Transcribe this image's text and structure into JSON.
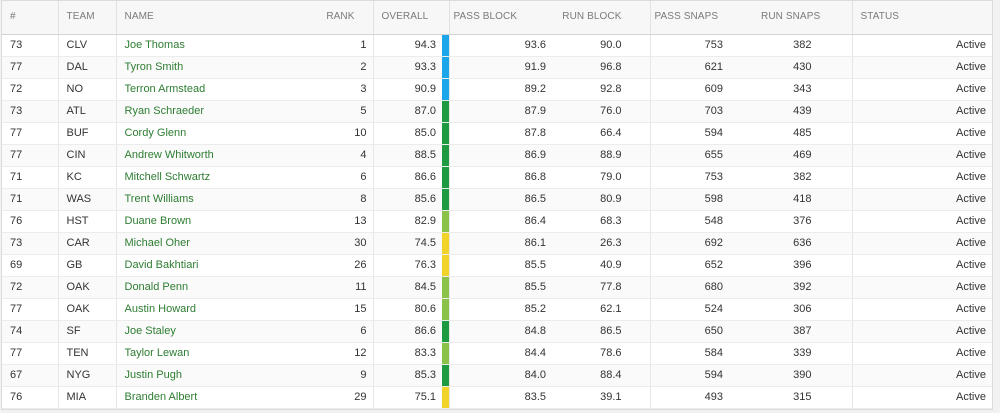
{
  "colors": {
    "tier_blue": "#1aa6e8",
    "tier_green_dark": "#1e9a41",
    "tier_green_light": "#8bc34a",
    "tier_yellow": "#f2d32a",
    "name_link": "#2e7d32"
  },
  "table": {
    "headers": {
      "num": "#",
      "team": "TEAM",
      "name": "NAME",
      "rank": "RANK",
      "overall": "OVERALL",
      "pass_block": "PASS BLOCK",
      "run_block": "RUN BLOCK",
      "pass_snaps": "PASS SNAPS",
      "run_snaps": "RUN SNAPS",
      "status": "STATUS"
    },
    "sort": {
      "column": "pass_block",
      "direction": "descending"
    },
    "rows": [
      {
        "num": "73",
        "team": "CLV",
        "name": "Joe Thomas",
        "rank": "1",
        "overall": "94.3",
        "tier": "blue",
        "pass_block": "93.6",
        "run_block": "90.0",
        "pass_snaps": "753",
        "run_snaps": "382",
        "status": "Active"
      },
      {
        "num": "77",
        "team": "DAL",
        "name": "Tyron Smith",
        "rank": "2",
        "overall": "93.3",
        "tier": "blue",
        "pass_block": "91.9",
        "run_block": "96.8",
        "pass_snaps": "621",
        "run_snaps": "430",
        "status": "Active"
      },
      {
        "num": "72",
        "team": "NO",
        "name": "Terron Armstead",
        "rank": "3",
        "overall": "90.9",
        "tier": "blue",
        "pass_block": "89.2",
        "run_block": "92.8",
        "pass_snaps": "609",
        "run_snaps": "343",
        "status": "Active"
      },
      {
        "num": "73",
        "team": "ATL",
        "name": "Ryan Schraeder",
        "rank": "5",
        "overall": "87.0",
        "tier": "green_dark",
        "pass_block": "87.9",
        "run_block": "76.0",
        "pass_snaps": "703",
        "run_snaps": "439",
        "status": "Active"
      },
      {
        "num": "77",
        "team": "BUF",
        "name": "Cordy Glenn",
        "rank": "10",
        "overall": "85.0",
        "tier": "green_dark",
        "pass_block": "87.8",
        "run_block": "66.4",
        "pass_snaps": "594",
        "run_snaps": "485",
        "status": "Active"
      },
      {
        "num": "77",
        "team": "CIN",
        "name": "Andrew Whitworth",
        "rank": "4",
        "overall": "88.5",
        "tier": "green_dark",
        "pass_block": "86.9",
        "run_block": "88.9",
        "pass_snaps": "655",
        "run_snaps": "469",
        "status": "Active"
      },
      {
        "num": "71",
        "team": "KC",
        "name": "Mitchell Schwartz",
        "rank": "6",
        "overall": "86.6",
        "tier": "green_dark",
        "pass_block": "86.8",
        "run_block": "79.0",
        "pass_snaps": "753",
        "run_snaps": "382",
        "status": "Active"
      },
      {
        "num": "71",
        "team": "WAS",
        "name": "Trent Williams",
        "rank": "8",
        "overall": "85.6",
        "tier": "green_dark",
        "pass_block": "86.5",
        "run_block": "80.9",
        "pass_snaps": "598",
        "run_snaps": "418",
        "status": "Active"
      },
      {
        "num": "76",
        "team": "HST",
        "name": "Duane Brown",
        "rank": "13",
        "overall": "82.9",
        "tier": "green_light",
        "pass_block": "86.4",
        "run_block": "68.3",
        "pass_snaps": "548",
        "run_snaps": "376",
        "status": "Active"
      },
      {
        "num": "73",
        "team": "CAR",
        "name": "Michael Oher",
        "rank": "30",
        "overall": "74.5",
        "tier": "yellow",
        "pass_block": "86.1",
        "run_block": "26.3",
        "pass_snaps": "692",
        "run_snaps": "636",
        "status": "Active"
      },
      {
        "num": "69",
        "team": "GB",
        "name": "David Bakhtiari",
        "rank": "26",
        "overall": "76.3",
        "tier": "yellow",
        "pass_block": "85.5",
        "run_block": "40.9",
        "pass_snaps": "652",
        "run_snaps": "396",
        "status": "Active"
      },
      {
        "num": "72",
        "team": "OAK",
        "name": "Donald Penn",
        "rank": "11",
        "overall": "84.5",
        "tier": "green_light",
        "pass_block": "85.5",
        "run_block": "77.8",
        "pass_snaps": "680",
        "run_snaps": "392",
        "status": "Active"
      },
      {
        "num": "77",
        "team": "OAK",
        "name": "Austin Howard",
        "rank": "15",
        "overall": "80.6",
        "tier": "green_light",
        "pass_block": "85.2",
        "run_block": "62.1",
        "pass_snaps": "524",
        "run_snaps": "306",
        "status": "Active"
      },
      {
        "num": "74",
        "team": "SF",
        "name": "Joe Staley",
        "rank": "6",
        "overall": "86.6",
        "tier": "green_dark",
        "pass_block": "84.8",
        "run_block": "86.5",
        "pass_snaps": "650",
        "run_snaps": "387",
        "status": "Active"
      },
      {
        "num": "77",
        "team": "TEN",
        "name": "Taylor Lewan",
        "rank": "12",
        "overall": "83.3",
        "tier": "green_light",
        "pass_block": "84.4",
        "run_block": "78.6",
        "pass_snaps": "584",
        "run_snaps": "339",
        "status": "Active"
      },
      {
        "num": "67",
        "team": "NYG",
        "name": "Justin Pugh",
        "rank": "9",
        "overall": "85.3",
        "tier": "green_dark",
        "pass_block": "84.0",
        "run_block": "88.4",
        "pass_snaps": "594",
        "run_snaps": "390",
        "status": "Active"
      },
      {
        "num": "76",
        "team": "MIA",
        "name": "Branden Albert",
        "rank": "29",
        "overall": "75.1",
        "tier": "yellow",
        "pass_block": "83.5",
        "run_block": "39.1",
        "pass_snaps": "493",
        "run_snaps": "315",
        "status": "Active"
      }
    ]
  }
}
